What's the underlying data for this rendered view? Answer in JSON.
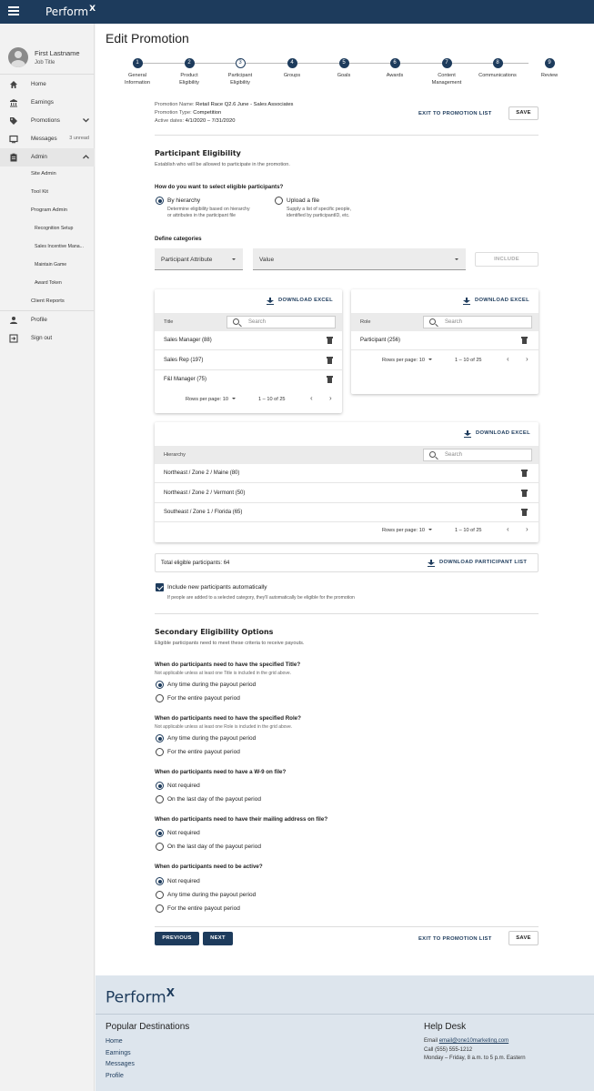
{
  "app": {
    "logo": "Perform",
    "logo_mark": "X"
  },
  "profile": {
    "name": "First Lastname",
    "job_title": "Job Title"
  },
  "sidebar": {
    "items": [
      {
        "label": "Home"
      },
      {
        "label": "Earnings"
      },
      {
        "label": "Promotions"
      },
      {
        "label": "Messages",
        "extra": "3 unread"
      },
      {
        "label": "Admin"
      }
    ],
    "admin_sub": [
      "Site Admin",
      "Tool Kit",
      "Program Admin"
    ],
    "program_admin_sub": [
      "Recognition Setup",
      "Sales Incentive Mana...",
      "Maintain Game",
      "Award Token"
    ],
    "client_reports": "Client Reports",
    "profile": "Profile",
    "sign_out": "Sign out"
  },
  "page": {
    "title": "Edit Promotion"
  },
  "stepper": {
    "steps": [
      {
        "num": "1",
        "label1": "General",
        "label2": "Information"
      },
      {
        "num": "2",
        "label1": "Product",
        "label2": "Eligibility"
      },
      {
        "num": "3",
        "label1": "Participant",
        "label2": "Eligibility"
      },
      {
        "num": "4",
        "label1": "Groups",
        "label2": ""
      },
      {
        "num": "5",
        "label1": "Goals",
        "label2": ""
      },
      {
        "num": "6",
        "label1": "Awards",
        "label2": ""
      },
      {
        "num": "7",
        "label1": "Content",
        "label2": "Management"
      },
      {
        "num": "8",
        "label1": "Communications",
        "label2": ""
      },
      {
        "num": "9",
        "label1": "Review",
        "label2": ""
      }
    ]
  },
  "promo": {
    "name_label": "Promotion Name:",
    "name": "Retail Race Q2.6 June - Sales Associates",
    "type_label": "Promotion Type:",
    "type": "Competition",
    "dates_label": "Active dates:",
    "dates": "4/1/2020 – 7/31/2020",
    "exit_label": "EXIT TO PROMOTION LIST",
    "save_label": "SAVE"
  },
  "eligibility": {
    "heading": "Participant Eligibility",
    "subtitle": "Establish who will be allowed to participate in the promotion.",
    "question": "How do you want to select eligible participants?",
    "opt1_label": "By hierarchy",
    "opt1_desc1": "Determine eligibility based on hierarchy",
    "opt1_desc2": "or attributes in the participant file",
    "opt2_label": "Upload a file",
    "opt2_desc1": "Supply a list of specific people,",
    "opt2_desc2": "identified by participantID, etc.",
    "categories_label": "Define categories",
    "attr_select": "Participant Attribute",
    "value_select": "Value",
    "include_label": "INCLUDE"
  },
  "title_table": {
    "download": "DOWNLOAD EXCEL",
    "header": "Title",
    "search_placeholder": "Search",
    "rows": [
      "Sales Manager (88)",
      "Sales Rep (197)",
      "F&I Manager (75)"
    ],
    "rows_per_page": "Rows per page: 10",
    "range": "1 – 10 of 25"
  },
  "role_table": {
    "download": "DOWNLOAD EXCEL",
    "header": "Role",
    "search_placeholder": "Search",
    "rows": [
      "Participant (256)"
    ],
    "rows_per_page": "Rows per page: 10",
    "range": "1 – 10 of 25"
  },
  "hierarchy_table": {
    "download": "DOWNLOAD EXCEL",
    "header": "Hierarchy",
    "search_placeholder": "Search",
    "rows": [
      "Northeast / Zone 2 / Maine (80)",
      "Northeast / Zone 2 / Vermont (50)",
      "Southeast / Zone 1 / Florida (65)"
    ],
    "rows_per_page": "Rows per page: 10",
    "range": "1 – 10 of 25"
  },
  "total": {
    "label": "Total eligible participants: 64",
    "download": "DOWNLOAD PARTICIPANT LIST"
  },
  "include_new": {
    "label": "Include new participants automatically",
    "desc": "If people are added to a selected category, they'll automatically be eligible for the promotion"
  },
  "secondary": {
    "heading": "Secondary Eligibility Options",
    "subtitle": "Eligible participants need to meet these criteria to receive payouts.",
    "q1": "When do participants need to have the specified Title?",
    "q1_note": "Not applicable unless at least one Title is included in the grid above.",
    "q1_o1": "Any time during the payout period",
    "q1_o2": "For the entire payout period",
    "q2": "When do participants need to have the specified Role?",
    "q2_note": "Not applicable unless at least one Role is included in the grid above.",
    "q2_o1": "Any time during the payout period",
    "q2_o2": "For the entire payout period",
    "q3": "When do participants need to have a W-9 on file?",
    "q3_o1": "Not required",
    "q3_o2": "On the last day of the payout period",
    "q4": "When do participants need to have their mailing address on file?",
    "q4_o1": "Not required",
    "q4_o2": "On the last day of the payout period",
    "q5": "When do participants need to be active?",
    "q5_o1": "Not required",
    "q5_o2": "Any time during the payout period",
    "q5_o3": "For the entire payout period"
  },
  "bottom": {
    "previous": "PREVIOUS",
    "next": "NEXT",
    "exit": "EXIT TO PROMOTION LIST",
    "save": "SAVE"
  },
  "footer": {
    "logo": "Perform",
    "logo_mark": "X",
    "destinations_heading": "Popular Destinations",
    "links": [
      "Home",
      "Earnings",
      "Messages",
      "Profile"
    ],
    "help_heading": "Help Desk",
    "email_label": "Email",
    "email": "email@one10marketing.com",
    "phone": "Call (555) 555-1212",
    "hours": "Monday – Friday, 8 a.m. to 5 p.m. Eastern"
  },
  "colors": {
    "brand": "#1d3b5c",
    "footer_bg": "#dde5ed"
  }
}
